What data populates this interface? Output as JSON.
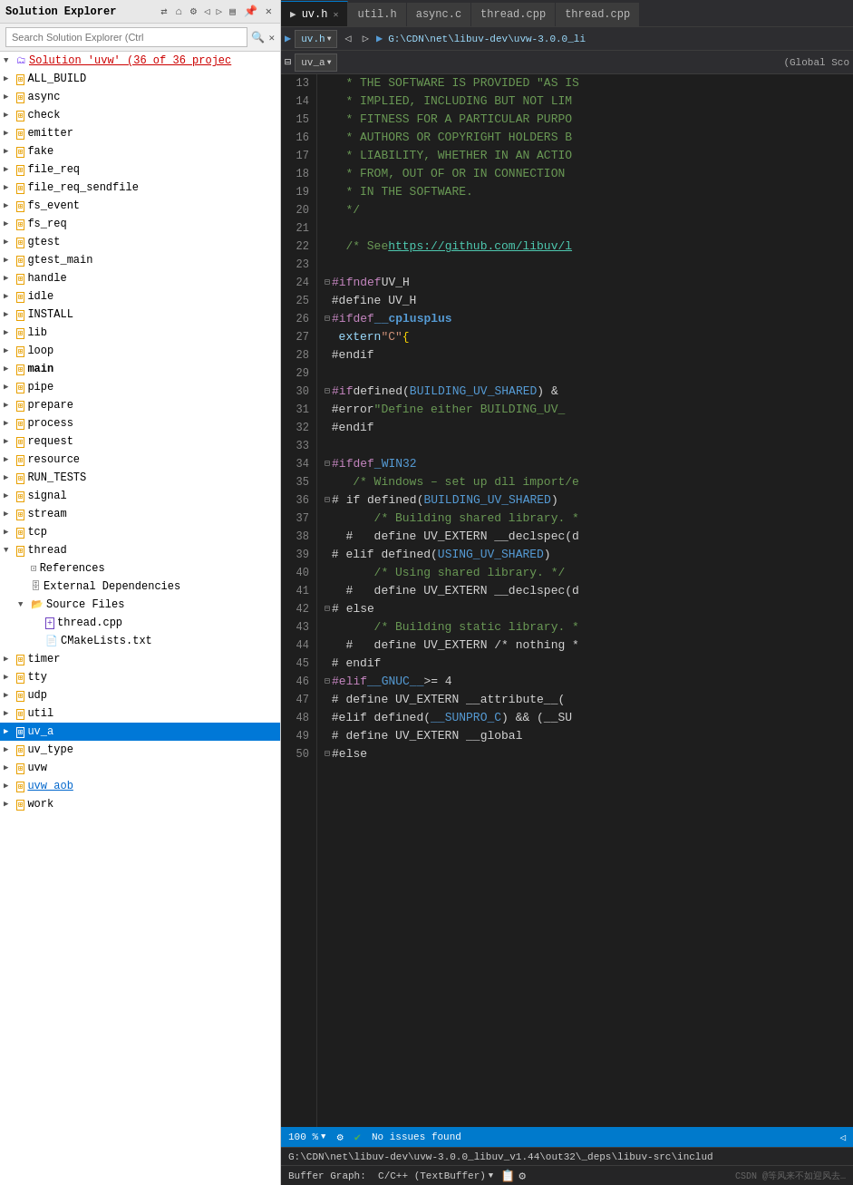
{
  "solution_explorer": {
    "title": "Solution Explorer",
    "search_placeholder": "Search Solution Explorer (Ctrl",
    "solution_label": "Solution 'uvw' (36 of 36 projec",
    "items": [
      {
        "id": "ALL_BUILD",
        "label": "ALL_BUILD",
        "level": 1,
        "expanded": false,
        "type": "project"
      },
      {
        "id": "async",
        "label": "async",
        "level": 1,
        "expanded": false,
        "type": "project"
      },
      {
        "id": "check",
        "label": "check",
        "level": 1,
        "expanded": false,
        "type": "project"
      },
      {
        "id": "emitter",
        "label": "emitter",
        "level": 1,
        "expanded": false,
        "type": "project"
      },
      {
        "id": "fake",
        "label": "fake",
        "level": 1,
        "expanded": false,
        "type": "project"
      },
      {
        "id": "file_req",
        "label": "file_req",
        "level": 1,
        "expanded": false,
        "type": "project"
      },
      {
        "id": "file_req_sendfile",
        "label": "file_req_sendfile",
        "level": 1,
        "expanded": false,
        "type": "project"
      },
      {
        "id": "fs_event",
        "label": "fs_event",
        "level": 1,
        "expanded": false,
        "type": "project"
      },
      {
        "id": "fs_req",
        "label": "fs_req",
        "level": 1,
        "expanded": false,
        "type": "project"
      },
      {
        "id": "gtest",
        "label": "gtest",
        "level": 1,
        "expanded": false,
        "type": "project"
      },
      {
        "id": "gtest_main",
        "label": "gtest_main",
        "level": 1,
        "expanded": false,
        "type": "project"
      },
      {
        "id": "handle",
        "label": "handle",
        "level": 1,
        "expanded": false,
        "type": "project"
      },
      {
        "id": "idle",
        "label": "idle",
        "level": 1,
        "expanded": false,
        "type": "project"
      },
      {
        "id": "INSTALL",
        "label": "INSTALL",
        "level": 1,
        "expanded": false,
        "type": "project"
      },
      {
        "id": "lib",
        "label": "lib",
        "level": 1,
        "expanded": false,
        "type": "project"
      },
      {
        "id": "loop",
        "label": "loop",
        "level": 1,
        "expanded": false,
        "type": "project"
      },
      {
        "id": "main",
        "label": "main",
        "level": 1,
        "expanded": false,
        "type": "project",
        "bold": true
      },
      {
        "id": "pipe",
        "label": "pipe",
        "level": 1,
        "expanded": false,
        "type": "project"
      },
      {
        "id": "prepare",
        "label": "prepare",
        "level": 1,
        "expanded": false,
        "type": "project"
      },
      {
        "id": "process",
        "label": "process",
        "level": 1,
        "expanded": false,
        "type": "project"
      },
      {
        "id": "request",
        "label": "request",
        "level": 1,
        "expanded": false,
        "type": "project"
      },
      {
        "id": "resource",
        "label": "resource",
        "level": 1,
        "expanded": false,
        "type": "project"
      },
      {
        "id": "RUN_TESTS",
        "label": "RUN_TESTS",
        "level": 1,
        "expanded": false,
        "type": "project"
      },
      {
        "id": "signal",
        "label": "signal",
        "level": 1,
        "expanded": false,
        "type": "project"
      },
      {
        "id": "stream",
        "label": "stream",
        "level": 1,
        "expanded": false,
        "type": "project"
      },
      {
        "id": "tcp",
        "label": "tcp",
        "level": 1,
        "expanded": false,
        "type": "project"
      },
      {
        "id": "thread",
        "label": "thread",
        "level": 1,
        "expanded": true,
        "type": "project"
      },
      {
        "id": "References",
        "label": "References",
        "level": 2,
        "expanded": false,
        "type": "refs"
      },
      {
        "id": "External_Dependencies",
        "label": "External Dependencies",
        "level": 2,
        "expanded": false,
        "type": "deps"
      },
      {
        "id": "Source_Files",
        "label": "Source Files",
        "level": 2,
        "expanded": true,
        "type": "folder"
      },
      {
        "id": "thread_cpp",
        "label": "thread.cpp",
        "level": 3,
        "expanded": false,
        "type": "cpp"
      },
      {
        "id": "CMakeLists_txt",
        "label": "CMakeLists.txt",
        "level": 3,
        "expanded": false,
        "type": "txt"
      },
      {
        "id": "timer",
        "label": "timer",
        "level": 1,
        "expanded": false,
        "type": "project"
      },
      {
        "id": "tty",
        "label": "tty",
        "level": 1,
        "expanded": false,
        "type": "project"
      },
      {
        "id": "udp",
        "label": "udp",
        "level": 1,
        "expanded": false,
        "type": "project"
      },
      {
        "id": "util",
        "label": "util",
        "level": 1,
        "expanded": false,
        "type": "project"
      },
      {
        "id": "uv_a",
        "label": "uv_a",
        "level": 1,
        "expanded": false,
        "type": "project",
        "selected": true
      },
      {
        "id": "uv_type",
        "label": "uv_type",
        "level": 1,
        "expanded": false,
        "type": "project"
      },
      {
        "id": "uvw",
        "label": "uvw",
        "level": 1,
        "expanded": false,
        "type": "project"
      },
      {
        "id": "uvw_aob",
        "label": "uvw_aob",
        "level": 1,
        "expanded": false,
        "type": "project",
        "underline": true
      },
      {
        "id": "work",
        "label": "work",
        "level": 1,
        "expanded": false,
        "type": "project"
      }
    ]
  },
  "tabs": [
    {
      "label": "uv.h",
      "active": true,
      "modified": false,
      "closable": true
    },
    {
      "label": "util.h",
      "active": false,
      "modified": false,
      "closable": false
    },
    {
      "label": "async.c",
      "active": false,
      "modified": false,
      "closable": false
    },
    {
      "label": "thread.cpp",
      "active": false,
      "modified": false,
      "closable": false
    },
    {
      "label": "thread.cpp",
      "active": false,
      "modified": false,
      "closable": false
    }
  ],
  "editor": {
    "active_file": "uv.h",
    "file_path": "G:\\CDN\\net\\libuv-dev\\uvw-3.0.0_li",
    "scope_dropdown": "uv_a",
    "global_scope": "(Global Sco",
    "zoom": "100 %",
    "status": "No issues found",
    "bottom_path": "G:\\CDN\\net\\libuv-dev\\uvw-3.0.0_libuv_v1.44\\out32\\_deps\\libuv-src\\includ",
    "buffer_graph": "Buffer Graph:  C/C++ (TextBuffer)"
  },
  "code_lines": [
    {
      "num": 13,
      "content": "comment_as_is"
    },
    {
      "num": 14,
      "content": "comment_implied"
    },
    {
      "num": 15,
      "content": "comment_fitness"
    },
    {
      "num": 16,
      "content": "comment_authors"
    },
    {
      "num": 17,
      "content": "comment_liability"
    },
    {
      "num": 18,
      "content": "comment_from"
    },
    {
      "num": 19,
      "content": "comment_in_the"
    },
    {
      "num": 20,
      "content": "comment_close"
    },
    {
      "num": 21,
      "content": "empty"
    },
    {
      "num": 22,
      "content": "comment_see"
    },
    {
      "num": 23,
      "content": "empty"
    },
    {
      "num": 24,
      "content": "ifndef"
    },
    {
      "num": 25,
      "content": "define_uv_h"
    },
    {
      "num": 26,
      "content": "ifdef_cplusplus"
    },
    {
      "num": 27,
      "content": "extern_c"
    },
    {
      "num": 28,
      "content": "endif"
    },
    {
      "num": 29,
      "content": "empty"
    },
    {
      "num": 30,
      "content": "if_defined_building"
    },
    {
      "num": 31,
      "content": "error_define"
    },
    {
      "num": 32,
      "content": "endif"
    },
    {
      "num": 33,
      "content": "empty"
    },
    {
      "num": 34,
      "content": "ifdef_win32"
    },
    {
      "num": 35,
      "content": "comment_windows"
    },
    {
      "num": 36,
      "content": "if_building_shared"
    },
    {
      "num": 37,
      "content": "comment_building_shared"
    },
    {
      "num": 38,
      "content": "define_uv_extern_declspec1"
    },
    {
      "num": 39,
      "content": "elif_using_shared"
    },
    {
      "num": 40,
      "content": "comment_using_shared"
    },
    {
      "num": 41,
      "content": "define_uv_extern_declspec2"
    },
    {
      "num": 42,
      "content": "else"
    },
    {
      "num": 43,
      "content": "comment_building_static"
    },
    {
      "num": 44,
      "content": "define_uv_extern_nothing"
    },
    {
      "num": 45,
      "content": "endif_inner"
    },
    {
      "num": 46,
      "content": "elif_gnuc"
    },
    {
      "num": 47,
      "content": "define_uv_extern_attr"
    },
    {
      "num": 48,
      "content": "elif_sunpro"
    },
    {
      "num": 49,
      "content": "define_uv_extern_global"
    },
    {
      "num": 50,
      "content": "else_outer"
    }
  ],
  "status_bar": {
    "zoom": "100 %",
    "check_icon": "✓",
    "status_text": "No issues found"
  }
}
